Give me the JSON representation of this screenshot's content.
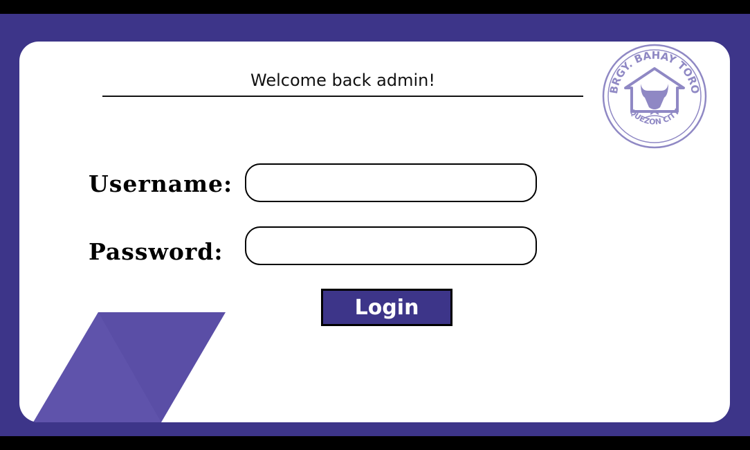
{
  "header": {
    "welcome_text": "Welcome back admin!"
  },
  "form": {
    "username_label": "Username:",
    "password_label": "Password:",
    "username_value": "",
    "password_value": "",
    "login_label": "Login"
  },
  "seal": {
    "top_text": "BRGY. BAHAY TORO",
    "bottom_text": "QUEZON CITY",
    "icon": "bull-house-icon"
  },
  "colors": {
    "brand": "#3d3589",
    "accent": "#5a4ea6",
    "seal": "#8f88c4"
  }
}
